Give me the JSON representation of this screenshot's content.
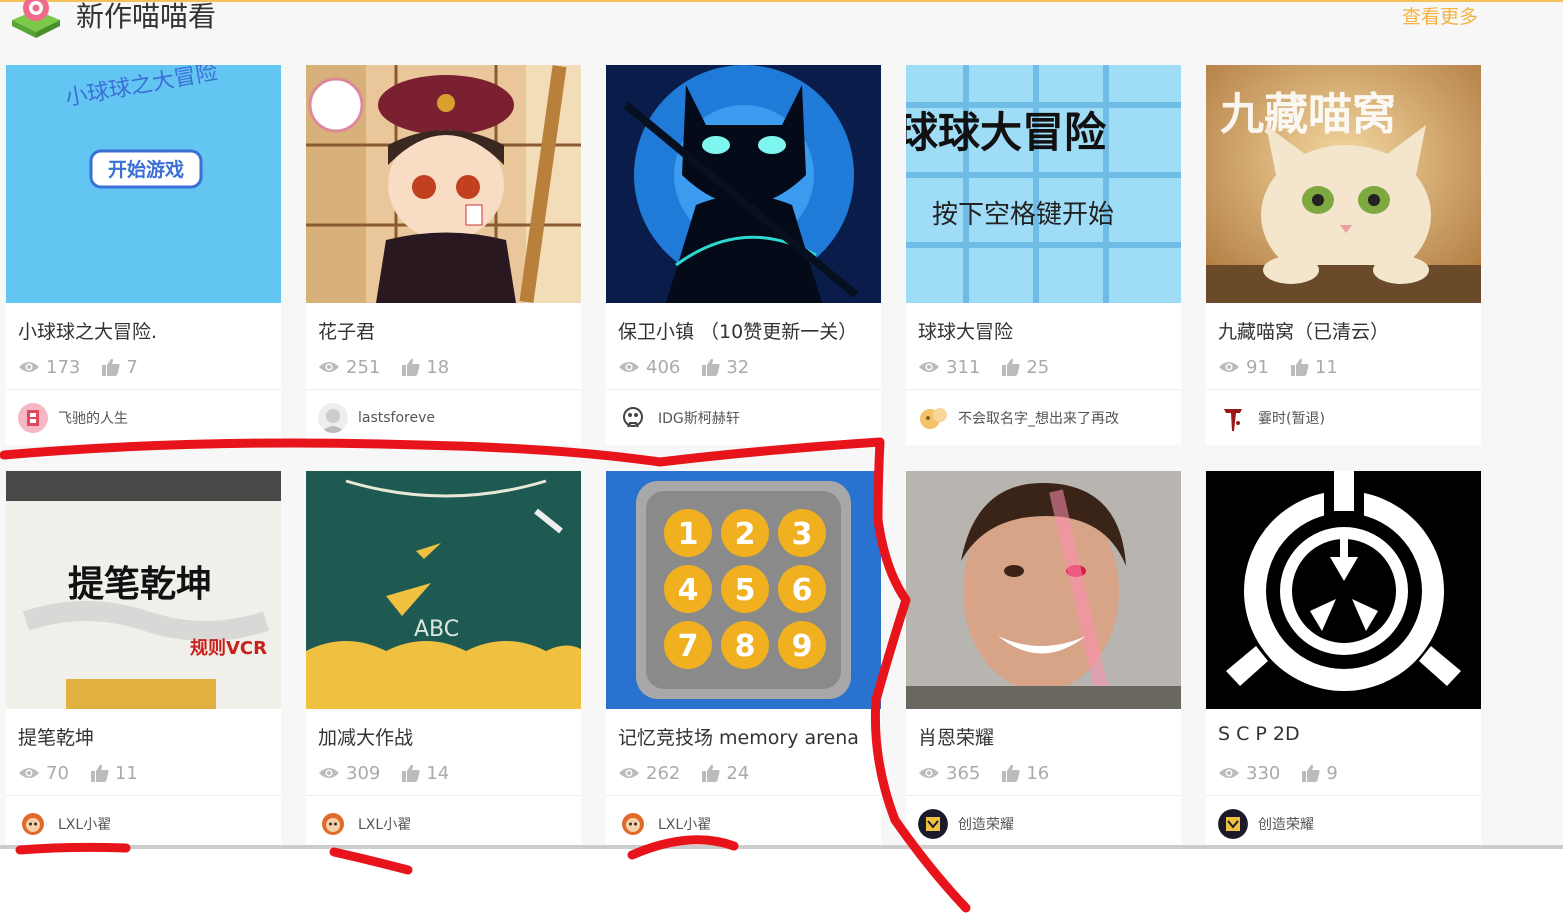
{
  "section": {
    "title": "新作喵喵看",
    "more_label": "查看更多"
  },
  "thumb_texts": {
    "c1": [
      "小球球之大冒险",
      "开始游戏"
    ],
    "c4": [
      "球球大冒险",
      "按下空格键开始"
    ],
    "c5": [
      "九藏喵窝"
    ],
    "c6": [
      "提笔乾坤",
      "规则VCR"
    ],
    "c7": [
      "ABC"
    ],
    "c8": [
      "1",
      "2",
      "3",
      "4",
      "5",
      "6",
      "7",
      "8",
      "9"
    ]
  },
  "cards": [
    {
      "title": "小球球之大冒险.",
      "views": "173",
      "likes": "7",
      "author": "飞驰的人生"
    },
    {
      "title": "花子君",
      "views": "251",
      "likes": "18",
      "author": "lastsforeve"
    },
    {
      "title": "保卫小镇 （10赞更新一关）",
      "views": "406",
      "likes": "32",
      "author": "IDG斯柯赫轩"
    },
    {
      "title": "球球大冒险",
      "views": "311",
      "likes": "25",
      "author": "不会取名字_想出来了再改"
    },
    {
      "title": "九藏喵窝（已清云）",
      "views": "91",
      "likes": "11",
      "author": "霎时(暂退)"
    },
    {
      "title": "提笔乾坤",
      "views": "70",
      "likes": "11",
      "author": "LXL小翟"
    },
    {
      "title": "加减大作战",
      "views": "309",
      "likes": "14",
      "author": "LXL小翟"
    },
    {
      "title": "记忆竞技场 memory arena",
      "views": "262",
      "likes": "24",
      "author": "LXL小翟"
    },
    {
      "title": "肖恩荣耀",
      "views": "365",
      "likes": "16",
      "author": "创造荣耀"
    },
    {
      "title": "S C P 2D",
      "views": "330",
      "likes": "9",
      "author": "创造荣耀"
    }
  ],
  "colors": {
    "accent": "#f5b340",
    "annotation": "#e8141c"
  }
}
